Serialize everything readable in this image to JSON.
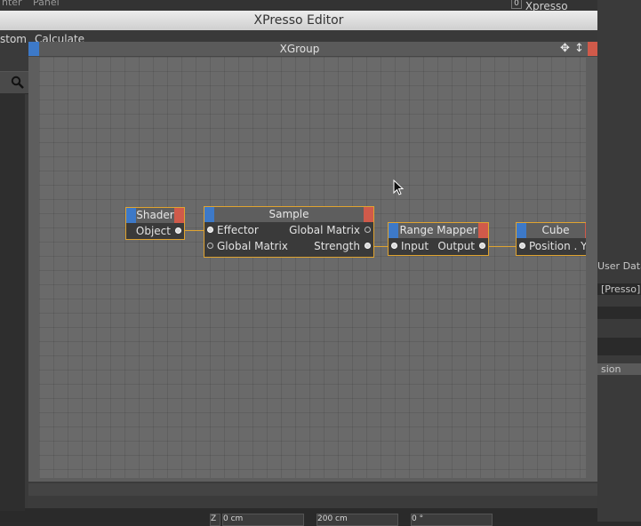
{
  "background": {
    "top_menu": [
      "nter",
      "Panel"
    ],
    "xpresso_tag": "Xpresso",
    "right_panel": {
      "user_data": "User Data",
      "presso_field": "[Presso]",
      "sion_field": "sion"
    },
    "bottom_fields": [
      "Z",
      "0 cm",
      "200 cm",
      "0 °"
    ]
  },
  "window": {
    "title": "XPresso Editor",
    "menu": [
      "stom",
      "Calculate"
    ]
  },
  "xgroup": {
    "title": "XGroup"
  },
  "nodes": {
    "shader": {
      "title": "Shader",
      "ports": {
        "output": "Object"
      }
    },
    "sample": {
      "title": "Sample",
      "inputs": [
        "Effector",
        "Global Matrix"
      ],
      "outputs": [
        "Global Matrix",
        "Strength"
      ]
    },
    "range_mapper": {
      "title": "Range Mapper",
      "input": "Input",
      "output": "Output"
    },
    "cube": {
      "title": "Cube",
      "input": "Position . Y"
    }
  },
  "colors": {
    "accent_wire": "#e0a430",
    "node_blue": "#3d79c8",
    "node_red": "#d05a4a"
  }
}
